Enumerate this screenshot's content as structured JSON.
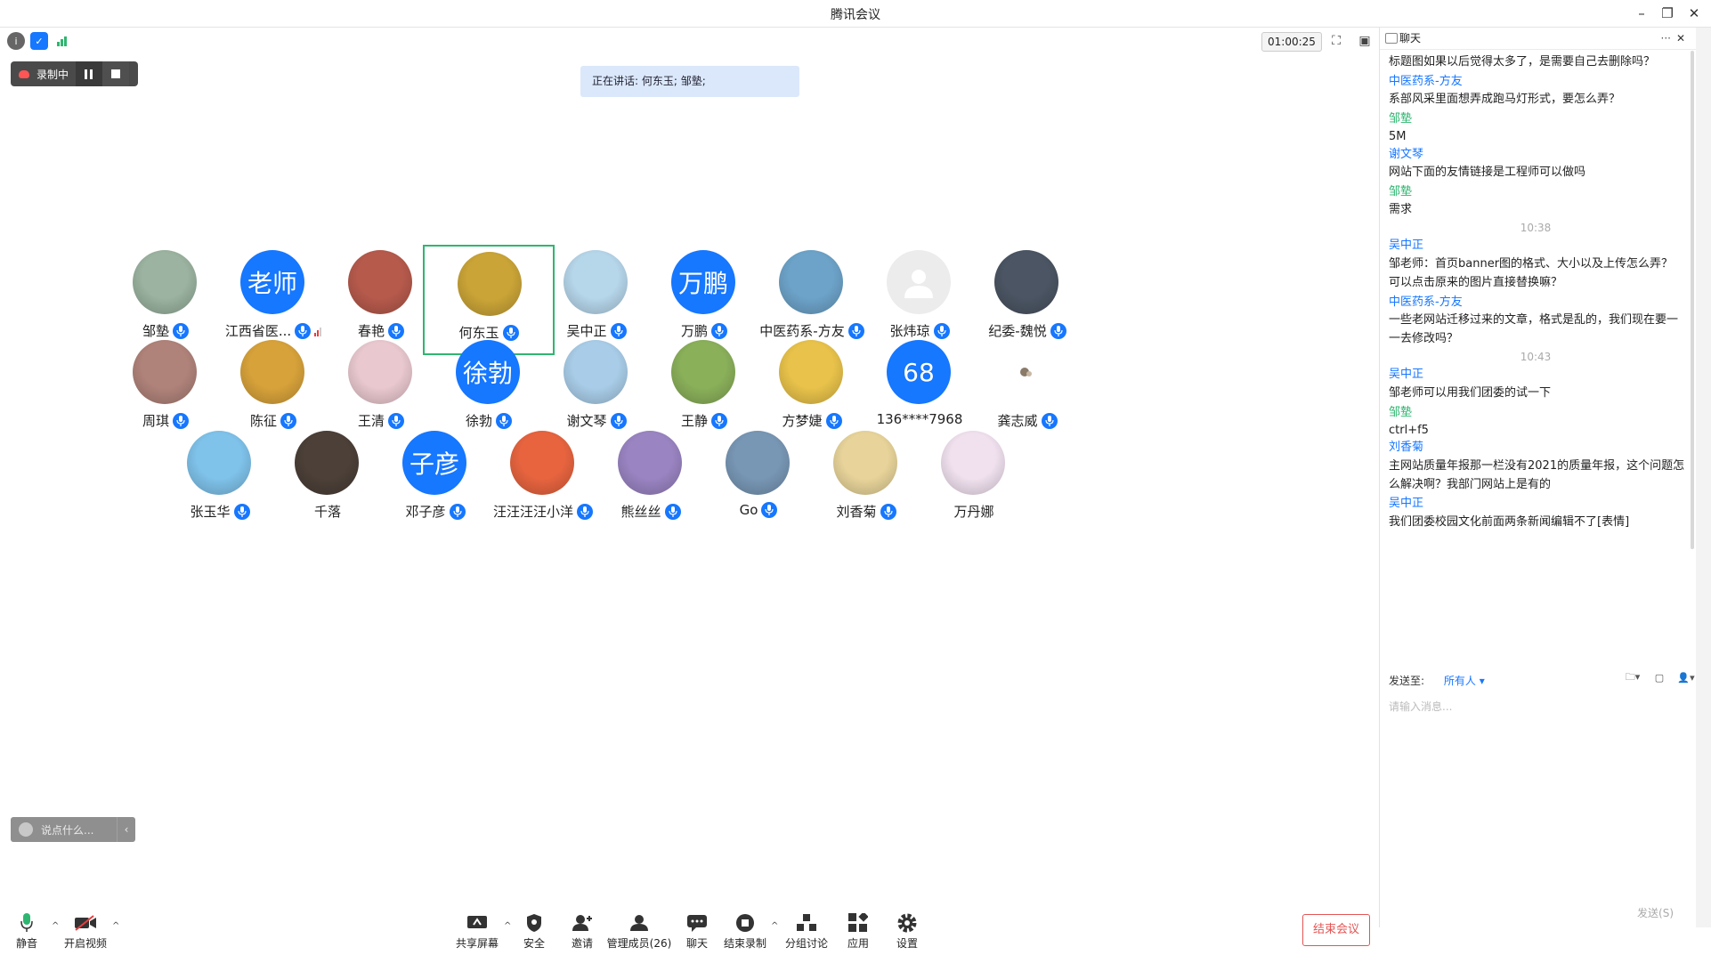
{
  "window": {
    "title": "腾讯会议"
  },
  "stage": {
    "timer": "01:00:25",
    "recording": {
      "label": "录制中"
    },
    "speaking_text": "正在讲话: 何东玉; 邹墊;"
  },
  "participants": [
    {
      "name": "邹墊",
      "avatar": "photo",
      "color": "#9bb3a0"
    },
    {
      "name": "江西省医...",
      "avatar": "text",
      "avatar_text": "老师",
      "signal": true
    },
    {
      "name": "春艳",
      "avatar": "photo",
      "color": "#b65a4c"
    },
    {
      "name": "何东玉",
      "avatar": "photo",
      "color": "#caa437",
      "active": true
    },
    {
      "name": "吴中正",
      "avatar": "photo",
      "color": "#b6d6ea"
    },
    {
      "name": "万鹏",
      "avatar": "text",
      "avatar_text": "万鹏"
    },
    {
      "name": "中医药系-方友",
      "avatar": "photo",
      "color": "#6da3c9"
    },
    {
      "name": "张炜琼",
      "avatar": "default"
    },
    {
      "name": "纪委-魏悦",
      "avatar": "photo",
      "color": "#4b5563"
    },
    {
      "name": "周琪",
      "avatar": "photo",
      "color": "#b0837a"
    },
    {
      "name": "陈征",
      "avatar": "photo",
      "color": "#d7a23a"
    },
    {
      "name": "王清",
      "avatar": "photo",
      "color": "#e9c8cf"
    },
    {
      "name": "徐勃",
      "avatar": "text",
      "avatar_text": "徐勃"
    },
    {
      "name": "谢文琴",
      "avatar": "photo",
      "color": "#a9cde8"
    },
    {
      "name": "王静",
      "avatar": "photo",
      "color": "#8ab05a"
    },
    {
      "name": "方梦婕",
      "avatar": "photo",
      "color": "#e8c24a"
    },
    {
      "name": "136****7968",
      "avatar": "number",
      "avatar_text": "68",
      "nomic": true
    },
    {
      "name": "龚志威",
      "avatar": "small",
      "color": "#ffffff"
    },
    {
      "name": "张玉华",
      "avatar": "photo",
      "color": "#7fc2ea"
    },
    {
      "name": "千落",
      "avatar": "photo",
      "color": "#4c4038",
      "nomic": true
    },
    {
      "name": "邓子彦",
      "avatar": "text",
      "avatar_text": "子彦"
    },
    {
      "name": "汪汪汪汪小洋",
      "avatar": "photo",
      "color": "#e7643f"
    },
    {
      "name": "熊丝丝",
      "avatar": "photo",
      "color": "#9a84c2"
    },
    {
      "name": "Go",
      "avatar": "photo",
      "color": "#7897b5"
    },
    {
      "name": "刘香菊",
      "avatar": "photo",
      "color": "#e8d49a"
    },
    {
      "name": "万丹娜",
      "avatar": "photo",
      "color": "#f1e1ef",
      "nomic": true
    }
  ],
  "saybox": {
    "placeholder": "说点什么..."
  },
  "toolbar": {
    "mute": "静音",
    "video": "开启视频",
    "share": "共享屏幕",
    "security": "安全",
    "invite": "邀请",
    "members": "管理成员(26)",
    "chat": "聊天",
    "stop_record": "结束录制",
    "breakout": "分组讨论",
    "apps": "应用",
    "settings": "设置",
    "end": "结束会议"
  },
  "chat": {
    "title": "聊天",
    "messages": [
      {
        "type": "text",
        "text": "标题图如果以后觉得太多了，是需要自己去删除吗？"
      },
      {
        "type": "sender",
        "text": "中医药系-方友"
      },
      {
        "type": "text",
        "text": "系部风采里面想弄成跑马灯形式，要怎么弄？"
      },
      {
        "type": "sender_g",
        "text": "邹墊"
      },
      {
        "type": "text",
        "text": "5M"
      },
      {
        "type": "sender",
        "text": "谢文琴"
      },
      {
        "type": "text",
        "text": "网站下面的友情链接是工程师可以做吗"
      },
      {
        "type": "sender_g",
        "text": "邹墊"
      },
      {
        "type": "text",
        "text": "需求"
      },
      {
        "type": "time",
        "text": "10:38"
      },
      {
        "type": "sender",
        "text": "吴中正"
      },
      {
        "type": "text",
        "text": "邹老师：首页banner图的格式、大小以及上传怎么弄？"
      },
      {
        "type": "text",
        "text": "可以点击原来的图片直接替换嘛？"
      },
      {
        "type": "sender",
        "text": "中医药系-方友"
      },
      {
        "type": "text",
        "text": "一些老网站迁移过来的文章，格式是乱的，我们现在要一"
      },
      {
        "type": "text",
        "text": "一去修改吗？"
      },
      {
        "type": "time",
        "text": "10:43"
      },
      {
        "type": "sender",
        "text": "吴中正"
      },
      {
        "type": "text",
        "text": "邹老师可以用我们团委的试一下"
      },
      {
        "type": "sender_g",
        "text": "邹墊"
      },
      {
        "type": "text",
        "text": "ctrl+f5"
      },
      {
        "type": "sender",
        "text": "刘香菊"
      },
      {
        "type": "text",
        "text": "主网站质量年报那一栏没有2021的质量年报，这个问题怎"
      },
      {
        "type": "text",
        "text": "么解决啊？我部门网站上是有的"
      },
      {
        "type": "sender",
        "text": "吴中正"
      },
      {
        "type": "text",
        "text": "我们团委校园文化前面两条新闻编辑不了[表情]"
      }
    ],
    "send_to_label": "发送至:",
    "send_to_value": "所有人",
    "input_placeholder": "请输入消息...",
    "send_button": "发送(S)"
  }
}
